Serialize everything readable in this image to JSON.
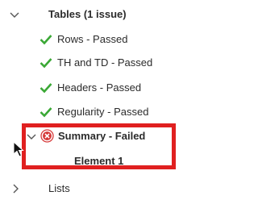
{
  "tree": {
    "tables": {
      "label": "Tables (1 issue)",
      "children": [
        {
          "label": "Rows - Passed",
          "status": "passed",
          "icon": "check-icon"
        },
        {
          "label": "TH and TD - Passed",
          "status": "passed",
          "icon": "check-icon"
        },
        {
          "label": "Headers - Passed",
          "status": "passed",
          "icon": "check-icon"
        },
        {
          "label": "Regularity - Passed",
          "status": "passed",
          "icon": "check-icon"
        },
        {
          "label": "Summary - Failed",
          "status": "failed",
          "icon": "error-icon",
          "children": [
            {
              "label": "Element 1"
            }
          ]
        }
      ]
    },
    "lists": {
      "label": "Lists"
    }
  },
  "colors": {
    "passed": "#3aa835",
    "failed": "#d63a3a",
    "highlight": "#e02020",
    "text": "#2b2b2b"
  }
}
